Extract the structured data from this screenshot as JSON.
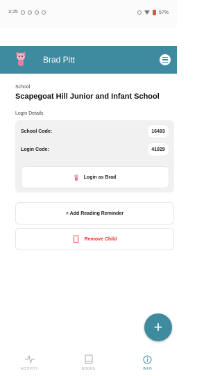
{
  "status_bar": {
    "time": "3:25",
    "battery": "57%"
  },
  "header": {
    "child_name": "Brad Pitt"
  },
  "school": {
    "label": "School",
    "name": "Scapegoat Hill Junior and Infant School"
  },
  "login": {
    "section_label": "Login Details",
    "school_code_label": "School Code:",
    "school_code": "16493",
    "login_code_label": "Login Code:",
    "login_code": "41029",
    "login_as_label": "Login as Brad"
  },
  "actions": {
    "add_reminder_label": "+ Add Reading Reminder",
    "remove_child_label": "Remove Child"
  },
  "fab": {
    "label": "+"
  },
  "bottom_nav": [
    {
      "label": "ACTIVITY"
    },
    {
      "label": "BOOKS"
    },
    {
      "label": "INFO"
    }
  ],
  "colors": {
    "accent": "#3e8b9f",
    "danger": "#e0322e"
  }
}
